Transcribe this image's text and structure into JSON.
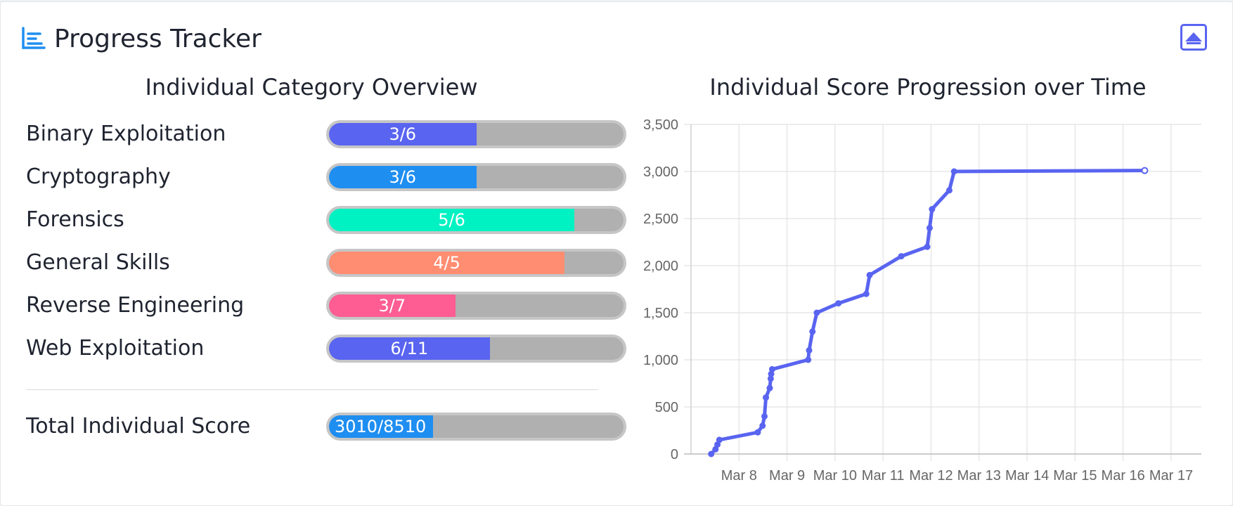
{
  "header": {
    "title": "Progress Tracker",
    "icon": "bar-chart-icon",
    "collapse_icon": "collapse-up-icon"
  },
  "category_overview": {
    "title": "Individual Category Overview",
    "categories": [
      {
        "label": "Binary Exploitation",
        "progress": "3/6",
        "fraction": 0.5,
        "color": "#5964f0"
      },
      {
        "label": "Cryptography",
        "progress": "3/6",
        "fraction": 0.5,
        "color": "#1f8ef1"
      },
      {
        "label": "Forensics",
        "progress": "5/6",
        "fraction": 0.8333,
        "color": "#00f2c3"
      },
      {
        "label": "General Skills",
        "progress": "4/5",
        "fraction": 0.8,
        "color": "#ff8d72"
      },
      {
        "label": "Reverse Engineering",
        "progress": "3/7",
        "fraction": 0.4286,
        "color": "#fd5d93"
      },
      {
        "label": "Web Exploitation",
        "progress": "6/11",
        "fraction": 0.5455,
        "color": "#5964f0"
      }
    ],
    "total": {
      "label": "Total Individual Score",
      "progress": "3010/8510",
      "fraction": 0.3537,
      "color": "#1f8ef1"
    }
  },
  "score_progression": {
    "title": "Individual Score Progression over Time",
    "chart_data": {
      "type": "line",
      "x_axis": {
        "ticks": [
          "Mar 8",
          "Mar 9",
          "Mar 10",
          "Mar 11",
          "Mar 12",
          "Mar 13",
          "Mar 14",
          "Mar 15",
          "Mar 16",
          "Mar 17"
        ],
        "range_days": [
          7.42,
          17.33
        ]
      },
      "y_axis": {
        "ticks": [
          "0",
          "500",
          "1,000",
          "1,500",
          "2,000",
          "2,500",
          "3,000",
          "3,500"
        ],
        "ylim": [
          0,
          3500
        ]
      },
      "grid": true,
      "line_color": "#5964f0",
      "series": [
        {
          "x_days": [
            7.42,
            7.51,
            7.55,
            7.59,
            8.39,
            8.49,
            8.53,
            8.56,
            8.64,
            8.66,
            8.67,
            8.69,
            9.44,
            9.46,
            9.53,
            9.62,
            10.07,
            10.65,
            10.72,
            11.38,
            11.92,
            11.97,
            12.02,
            12.38,
            12.48,
            16.45
          ],
          "y": [
            0,
            50,
            100,
            150,
            230,
            300,
            400,
            600,
            700,
            800,
            850,
            900,
            1000,
            1100,
            1300,
            1500,
            1600,
            1700,
            1900,
            2100,
            2200,
            2400,
            2600,
            2800,
            3000,
            3010
          ]
        }
      ]
    }
  }
}
